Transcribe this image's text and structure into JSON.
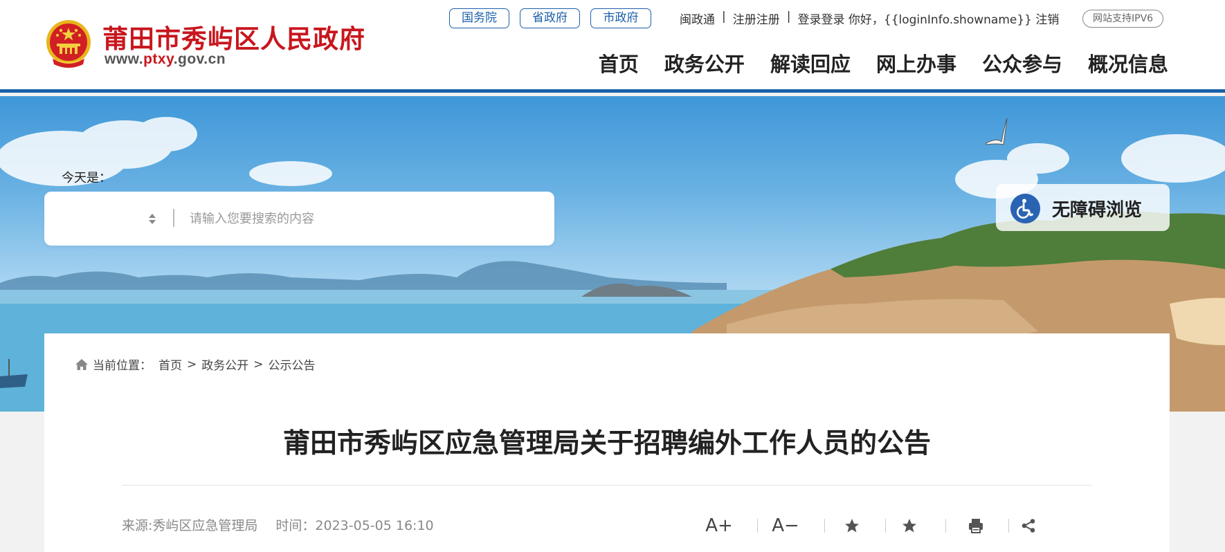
{
  "site": {
    "name": "莆田市秀屿区人民政府",
    "domain_prefix": "www.",
    "domain_highlight": "ptxy",
    "domain_suffix": ".gov.cn"
  },
  "gov_links": [
    "国务院",
    "省政府",
    "市政府"
  ],
  "top_links": {
    "minzhengtong": "闽政通",
    "register": "注册注册",
    "login_greeting": "登录登录 你好，{{loginInfo.showname}} 注销",
    "ipv6": "网站支持IPV6"
  },
  "main_nav": [
    "首页",
    "政务公开",
    "解读回应",
    "网上办事",
    "公众参与",
    "概况信息"
  ],
  "banner": {
    "today_label": "今天是：",
    "search_placeholder": "请输入您要搜索的内容",
    "accessibility_label": "无障碍浏览"
  },
  "breadcrumb": {
    "prefix": "当前位置：",
    "items": [
      "首页",
      "政务公开",
      "公示公告"
    ],
    "separator": ">"
  },
  "article": {
    "title": "莆田市秀屿区应急管理局关于招聘编外工作人员的公告",
    "source": "来源:秀屿区应急管理局",
    "time": "时间：2023-05-05 16:10"
  },
  "tools": {
    "font_increase": "A+",
    "font_decrease": "A−"
  },
  "colors": {
    "brand_red": "#c8161d",
    "brand_blue": "#1a5fa8",
    "accessibility_blue": "#2b63b3"
  },
  "icons": [
    "national-emblem-icon",
    "home-icon",
    "wheelchair-icon",
    "star-icon",
    "print-icon",
    "share-icon"
  ]
}
